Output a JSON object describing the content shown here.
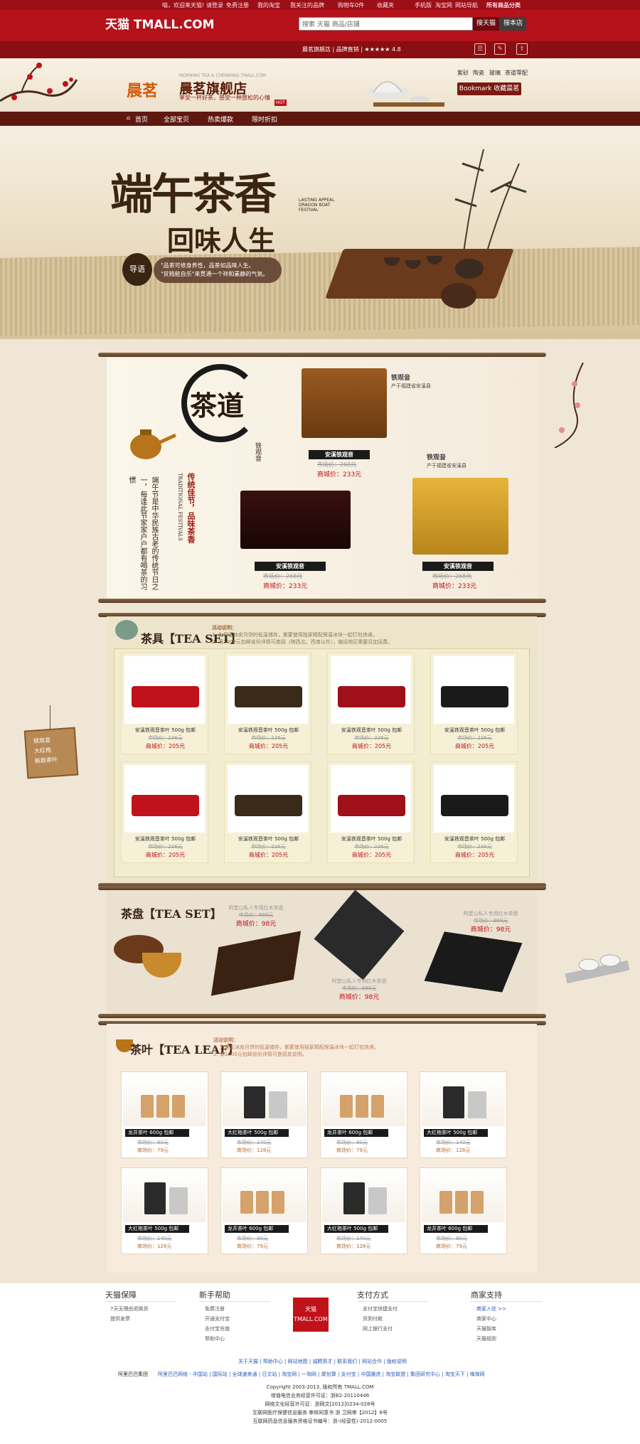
{
  "topnav": {
    "greeting": "喵，欢迎来天猫!",
    "login": "请登录",
    "register": "免费注册",
    "my_tmall": "我的淘宝",
    "fav_brand": "我关注的品牌",
    "cart": "购物车0件",
    "favorites": "收藏夹",
    "mobile": "手机版",
    "taobao": "淘宝网",
    "site_nav": "网站导航",
    "all_categories": "所有商品分类"
  },
  "header": {
    "logo": "天猫 TMALL.COM",
    "search_value": "搜索 天猫 商品/店铺",
    "search_tmall": "搜天猫",
    "search_store": "搜本店",
    "rating": "晨茗旗舰店 | 品牌直销 | ★★★★★ 4.8"
  },
  "store": {
    "logo_text": "晨茗",
    "en_name": "MORNING TEA & CHENMING.TMALL.COM",
    "name": "晨茗旗舰店",
    "slogan": "享受一杯好茶，感受一种放松的心情",
    "hot": "HOT",
    "quick_links": [
      "紫砂",
      "陶瓷",
      "玻璃",
      "茶道零配"
    ],
    "bookmark": "Bookmark 收藏晨茗"
  },
  "nav": [
    "首页",
    "全部宝贝",
    "热卖爆款",
    "限时折扣"
  ],
  "hero": {
    "title1": "端午茶香",
    "title2": "回味人生",
    "seal": "导语",
    "desc1": "\"品茶可修身养性，品茶如品味人生。",
    "desc2": "\"贫贱能自乐\"来贯通一个祥和素静的气氛。",
    "en": "LASTING APPEAL DRAGON BOAT FESTIVAL"
  },
  "sec1": {
    "ink_title": "茶道",
    "vtext_main": "端午节是中华民族古老的传统节日之一，每逢此节家家户户都有喝茶的习惯",
    "vtext_fest": "传统佳节，品味茶香",
    "vtext_en": "TRADITIONAL FESTIVALS",
    "tag_top": "铁观音",
    "tag_sub": "产于福建省安溪县",
    "tag_right": "铁观音",
    "products": [
      {
        "name": "安溪铁观音",
        "old": "市场价：268元",
        "new": "商城价：233元"
      },
      {
        "name": "安溪铁观音",
        "old": "市场价：268元",
        "new": "商城价：233元"
      },
      {
        "name": "安溪铁观音",
        "old": "市场价：268元",
        "new": "商城价：233元"
      }
    ]
  },
  "sec2": {
    "title": "茶具【TEA SET】",
    "note1": "活动说明：",
    "note2": "1. 为保证冰皮月饼的低温储存，紫蒙使用独家精配保温冰块一起打包快递。",
    "note3": "2. 满1000元包邮省份详情可查阅（除西北、西南以外），偏远地区需要另加运费。",
    "items": [
      {
        "name": "安溪铁观音茶叶 500g 包邮",
        "old": "市场价：236元",
        "new": "商城价：205元"
      },
      {
        "name": "安溪铁观音茶叶 500g 包邮",
        "old": "市场价：236元",
        "new": "商城价：205元"
      },
      {
        "name": "安溪铁观音茶叶 500g 包邮",
        "old": "市场价：236元",
        "new": "商城价：205元"
      },
      {
        "name": "安溪铁观音茶叶 500g 包邮",
        "old": "市场价：236元",
        "new": "商城价：205元"
      },
      {
        "name": "安溪铁观音茶叶 500g 包邮",
        "old": "市场价：236元",
        "new": "商城价：205元"
      },
      {
        "name": "安溪铁观音茶叶 500g 包邮",
        "old": "市场价：236元",
        "new": "商城价：205元"
      },
      {
        "name": "安溪铁观音茶叶 500g 包邮",
        "old": "市场价：236元",
        "new": "商城价：205元"
      },
      {
        "name": "安溪铁观音茶叶 500g 包邮",
        "old": "市场价：236元",
        "new": "商城价：205元"
      }
    ]
  },
  "sec3": {
    "title": "茶盘【TEA SET】",
    "items": [
      {
        "name": "阿堂山私人专用红木茶盘",
        "old": "市场价：998元",
        "new": "商城价：98元"
      },
      {
        "name": "阿堂山私人专用红木茶盘",
        "old": "市场价：998元",
        "new": "商城价：98元"
      },
      {
        "name": "阿堂山私人专用红木茶盘",
        "old": "市场价：998元",
        "new": "商城价：98元"
      }
    ]
  },
  "sec4": {
    "title": "茶叶【TEA LEAF】",
    "note1": "活动说明：",
    "note2": "1. 为保证冰皮月饼的低温储存，紫蒙使用独家精配保温冰块一起打包快递。",
    "note3": "2. 满1000元包邮省份详情可查阅其说明。",
    "items": [
      {
        "name": "龙井茶叶 600g 包邮",
        "old": "市场价：90元",
        "new": "商场价：79元"
      },
      {
        "name": "大红袍茶叶 500g 包邮",
        "old": "市场价：140元",
        "new": "商场价：128元"
      },
      {
        "name": "龙井茶叶 600g 包邮",
        "old": "市场价：90元",
        "new": "商场价：79元"
      },
      {
        "name": "大红袍茶叶 500g 包邮",
        "old": "市场价：140元",
        "new": "商场价：128元"
      },
      {
        "name": "大红袍茶叶 500g 包邮",
        "old": "市场价：140元",
        "new": "商场价：128元"
      },
      {
        "name": "龙井茶叶 600g 包邮",
        "old": "市场价：90元",
        "new": "商场价：79元"
      },
      {
        "name": "大红袍茶叶 500g 包邮",
        "old": "市场价：140元",
        "new": "商场价：128元"
      },
      {
        "name": "龙井茶叶 600g 包邮",
        "old": "市场价：90元",
        "new": "商场价：79元"
      }
    ]
  },
  "side_sign": [
    "铁观音",
    "大红袍",
    "新款茶叶"
  ],
  "footer": {
    "cols": [
      {
        "title": "天猫保障",
        "items": [
          "7天无理由退换货",
          "提供发票"
        ]
      },
      {
        "title": "新手帮助",
        "items": [
          "免费注册",
          "开通支付宝",
          "支付宝充值",
          "帮助中心"
        ]
      },
      {
        "title": "支付方式",
        "items": [
          "支付宝快捷支付",
          "货到付款",
          "网上银行支付"
        ]
      },
      {
        "title": "商家支持",
        "items": [
          "商家入驻 >>",
          "商家中心",
          "天猫智库",
          "天猫规则"
        ]
      }
    ],
    "tmall_badge": "天猫 TMALL.COM",
    "links1": "关于天猫 | 帮助中心 | 网站地图 | 诚聘英才 | 联系我们 | 网站合作 | 版权说明",
    "links2_label": "阿里巴巴集团",
    "links2": "阿里巴巴网络 - 中国站 | 国际站 | 全球速卖通 | 日文站 | 淘宝网 | 一淘网 | 聚划算 | 支付宝 | 中国雅虎 | 淘宝联盟 | 集团研究中心 | 淘宝天下 | 嗨淘网",
    "copy1": "Copyright 2003-2013, 版权所有 TMALL.COM",
    "copy2": "增值电信业务经营许可证：浙B2-20110446",
    "copy3": "网络文化经营许可证：浙网文[2012]0234-028号",
    "copy4": "互联网医疗保健信息服务 审核同意书 浙 卫网审【2012】6号",
    "copy5": "互联网药品信息服务资格证书编号：浙-(经营性)-2012-0005"
  },
  "colors": {
    "brand_red": "#b5121b",
    "dark_red": "#8a0e12",
    "price_red": "#c0121a",
    "nav_brown": "#5e1810"
  }
}
